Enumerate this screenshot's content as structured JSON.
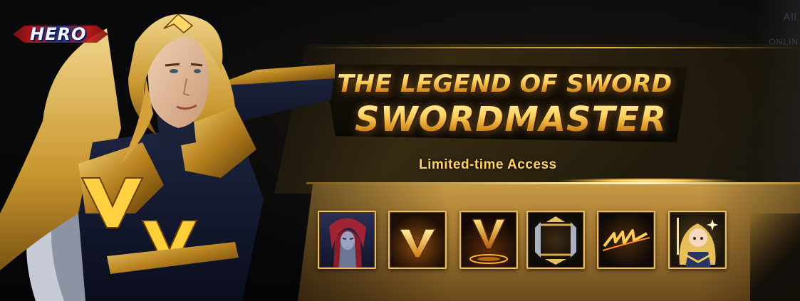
{
  "badge": {
    "label": "HERO"
  },
  "banner": {
    "title_line1": "THE LEGEND OF SWORD",
    "title_line2": "SWORDMASTER",
    "subtitle": "Limited-time Access"
  },
  "background_ui": {
    "top_right_text": "All",
    "right_text": "ONLIN"
  },
  "rewards": [
    {
      "icon": "hero-portrait-icon"
    },
    {
      "icon": "gold-v-emblem-icon"
    },
    {
      "icon": "gold-v-aura-emblem-icon"
    },
    {
      "icon": "gold-frame-icon"
    },
    {
      "icon": "gold-signature-icon"
    },
    {
      "icon": "chibi-swordmaster-icon"
    }
  ],
  "colors": {
    "gold": "#ffd25e",
    "gold_dark": "#8b4e0b",
    "tray": "#c79a45",
    "background": "#07070a"
  }
}
